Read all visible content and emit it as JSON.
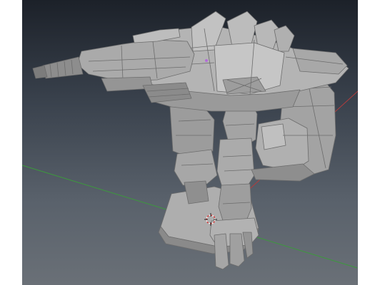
{
  "viewport": {
    "label": "3D viewport",
    "background_top": "#1c2129",
    "background_bottom": "#6a7077"
  },
  "scene": {
    "model": "mech-robot",
    "shading": "flat-gray",
    "model_color": "#a9a9a9",
    "axis_x_color": "#b43c3c",
    "axis_y_color": "#3c9a3c",
    "grid_color": "#5b636c",
    "selected_vertex_color": "#b36bd8"
  },
  "gizmo": {
    "icon": "3d-cursor-icon"
  }
}
